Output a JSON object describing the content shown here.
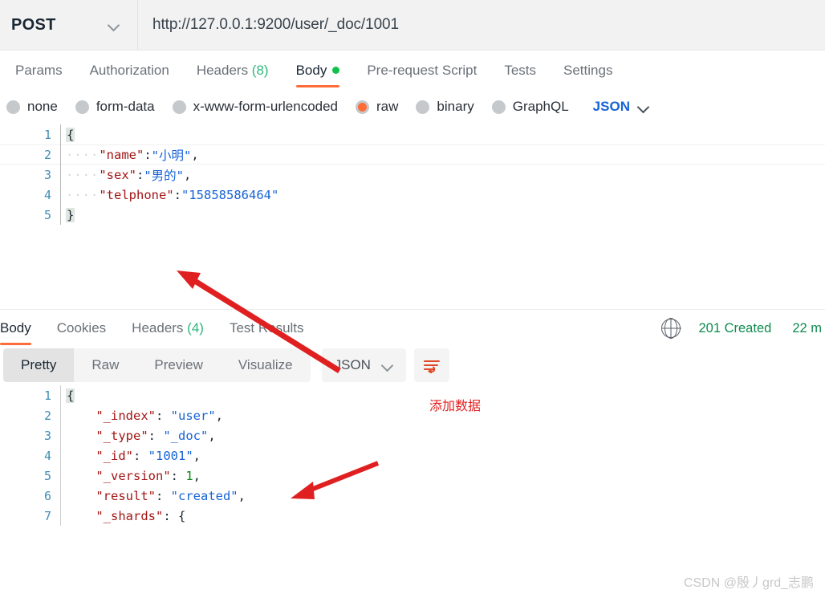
{
  "request": {
    "method": "POST",
    "url": "http://127.0.0.1:9200/user/_doc/1001",
    "tabs": [
      {
        "label": "Params",
        "count": "",
        "active": false,
        "dot": false
      },
      {
        "label": "Authorization",
        "count": "",
        "active": false,
        "dot": false
      },
      {
        "label": "Headers",
        "count": "(8)",
        "active": false,
        "dot": false
      },
      {
        "label": "Body",
        "count": "",
        "active": true,
        "dot": true
      },
      {
        "label": "Pre-request Script",
        "count": "",
        "active": false,
        "dot": false
      },
      {
        "label": "Tests",
        "count": "",
        "active": false,
        "dot": false
      },
      {
        "label": "Settings",
        "count": "",
        "active": false,
        "dot": false
      }
    ],
    "body_types": [
      {
        "label": "none",
        "selected": false
      },
      {
        "label": "form-data",
        "selected": false
      },
      {
        "label": "x-www-form-urlencoded",
        "selected": false
      },
      {
        "label": "raw",
        "selected": true
      },
      {
        "label": "binary",
        "selected": false
      },
      {
        "label": "GraphQL",
        "selected": false
      }
    ],
    "format_selected": "JSON",
    "body_lines": [
      {
        "n": "1",
        "indent": "",
        "text": "{",
        "kind": "brace"
      },
      {
        "n": "2",
        "indent": "····",
        "key": "\"name\"",
        "sep": ":",
        "value": "\"小明\"",
        "tail": ",",
        "kind": "pair",
        "highlight": true
      },
      {
        "n": "3",
        "indent": "····",
        "key": "\"sex\"",
        "sep": ":",
        "value": "\"男的\"",
        "tail": ",",
        "kind": "pair",
        "highlight": false
      },
      {
        "n": "4",
        "indent": "····",
        "key": "\"telphone\"",
        "sep": ":",
        "value": "\"15858586464\"",
        "tail": "",
        "kind": "pair",
        "highlight": false
      },
      {
        "n": "5",
        "indent": "",
        "text": "}",
        "kind": "brace"
      }
    ]
  },
  "response": {
    "tabs": [
      {
        "label": "Body",
        "count": "",
        "active": true
      },
      {
        "label": "Cookies",
        "count": "",
        "active": false
      },
      {
        "label": "Headers",
        "count": "(4)",
        "active": false
      },
      {
        "label": "Test Results",
        "count": "",
        "active": false
      }
    ],
    "status": "201 Created",
    "time": "22 m",
    "globe_icon": "globe-icon",
    "view_modes": [
      {
        "label": "Pretty",
        "active": true
      },
      {
        "label": "Raw",
        "active": false
      },
      {
        "label": "Preview",
        "active": false
      },
      {
        "label": "Visualize",
        "active": false
      }
    ],
    "format_selected": "JSON",
    "wrap_icon": "wrap-lines-icon",
    "body_lines": [
      {
        "n": "1",
        "indent": "",
        "text": "{",
        "kind": "brace"
      },
      {
        "n": "2",
        "indent": "    ",
        "key": "\"_index\"",
        "sep": ": ",
        "value": "\"user\"",
        "tail": ",",
        "kind": "pair",
        "vtype": "str"
      },
      {
        "n": "3",
        "indent": "    ",
        "key": "\"_type\"",
        "sep": ": ",
        "value": "\"_doc\"",
        "tail": ",",
        "kind": "pair",
        "vtype": "str"
      },
      {
        "n": "4",
        "indent": "    ",
        "key": "\"_id\"",
        "sep": ": ",
        "value": "\"1001\"",
        "tail": ",",
        "kind": "pair",
        "vtype": "str"
      },
      {
        "n": "5",
        "indent": "    ",
        "key": "\"_version\"",
        "sep": ": ",
        "value": "1",
        "tail": ",",
        "kind": "pair",
        "vtype": "num"
      },
      {
        "n": "6",
        "indent": "    ",
        "key": "\"result\"",
        "sep": ": ",
        "value": "\"created\"",
        "tail": ",",
        "kind": "pair",
        "vtype": "str"
      },
      {
        "n": "7",
        "indent": "    ",
        "key": "\"_shards\"",
        "sep": ": ",
        "value": "{",
        "tail": "",
        "kind": "pair",
        "vtype": "punc"
      }
    ]
  },
  "annotations": {
    "add_data_label": "添加数据"
  },
  "watermark": "CSDN @殷丿grd_志鹏",
  "colors": {
    "accent": "#ff6c37",
    "link": "#1763d6",
    "success": "#0e8a4e",
    "annotation": "#e02020"
  }
}
